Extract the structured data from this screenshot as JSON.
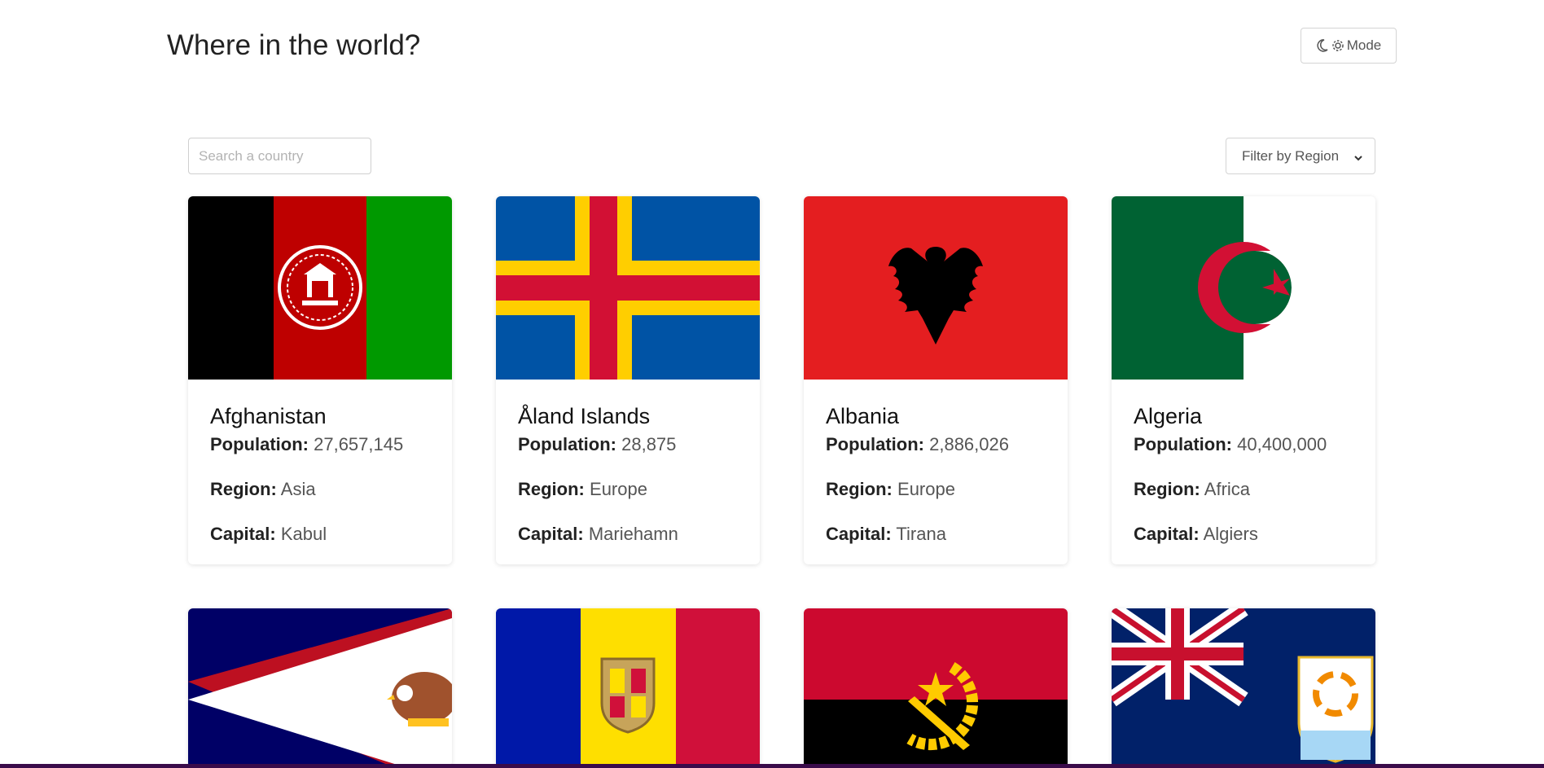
{
  "header": {
    "title": "Where in the world?",
    "mode_label": "Mode"
  },
  "search": {
    "placeholder": "Search a country",
    "value": ""
  },
  "filter": {
    "label": "Filter by Region"
  },
  "labels": {
    "population": "Population:",
    "region": "Region:",
    "capital": "Capital:"
  },
  "countries": [
    {
      "name": "Afghanistan",
      "population": "27,657,145",
      "region": "Asia",
      "capital": "Kabul",
      "flag": "afghanistan-flag"
    },
    {
      "name": "Åland Islands",
      "population": "28,875",
      "region": "Europe",
      "capital": "Mariehamn",
      "flag": "aland-islands-flag"
    },
    {
      "name": "Albania",
      "population": "2,886,026",
      "region": "Europe",
      "capital": "Tirana",
      "flag": "albania-flag"
    },
    {
      "name": "Algeria",
      "population": "40,400,000",
      "region": "Africa",
      "capital": "Algiers",
      "flag": "algeria-flag"
    }
  ],
  "partial_cards": [
    {
      "flag": "american-samoa-flag"
    },
    {
      "flag": "andorra-flag"
    },
    {
      "flag": "angola-flag"
    },
    {
      "flag": "anguilla-flag"
    }
  ]
}
